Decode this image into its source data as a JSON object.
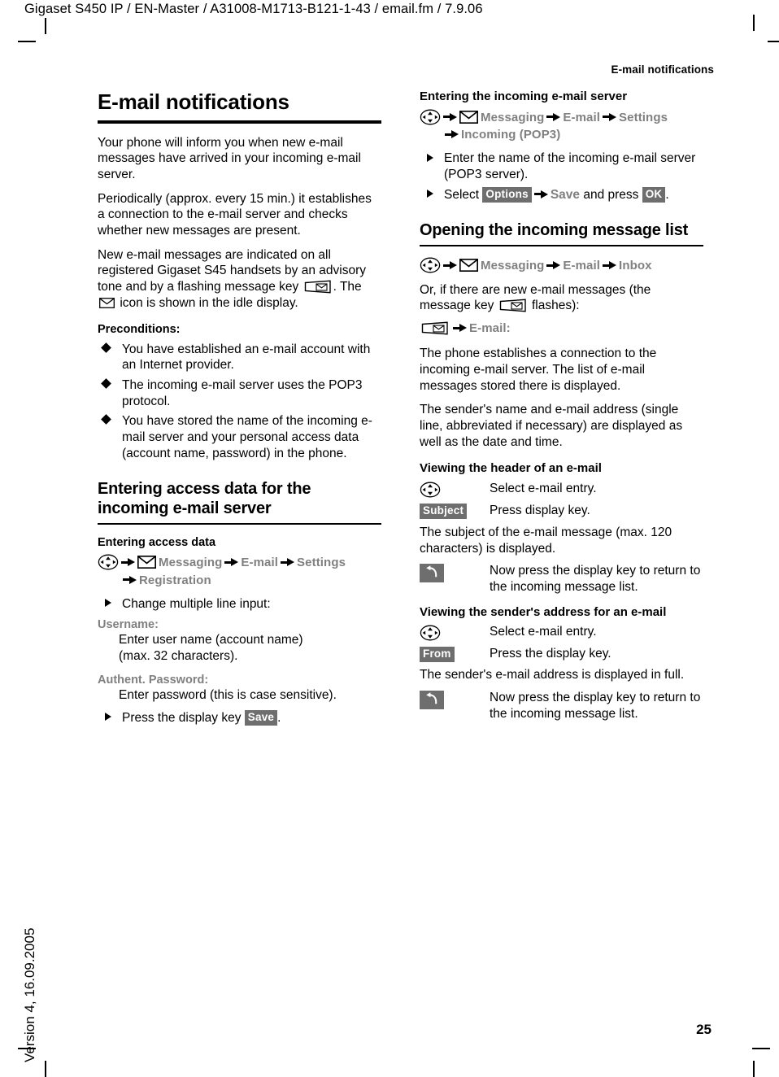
{
  "page": {
    "file_line": "Gigaset S450 IP / EN-Master / A31008-M1713-B121-1-43 / email.fm / 7.9.06",
    "running_head": "E-mail notifications",
    "version_text": "Version 4, 16.09.2005",
    "page_number": "25"
  },
  "left": {
    "chapter_title": "E-mail notifications",
    "intro1": "Your phone will inform you when new e-mail messages have arrived in your incoming e-mail server.",
    "intro2": "Periodically (approx. every 15 min.) it establishes a connection to the e-mail server and checks whether new messages are present.",
    "intro3_a": "New e-mail messages are indicated on all registered Gigaset S45 handsets by an advisory tone and by a flashing message key",
    "intro3_b": ". The",
    "intro3_c": "icon is shown in the idle display.",
    "preconditions_title": "Preconditions:",
    "preconditions": [
      "You have established an e-mail account with an Internet provider.",
      "The incoming e-mail server uses the POP3 protocol.",
      "You have stored the name of the incoming e-mail server and your personal access data (account name, password) in the phone."
    ],
    "section_title": "Entering access data for the incoming e-mail server",
    "access_sub": "Entering access data",
    "menu_path": {
      "item1": "Messaging",
      "item2": "E-mail",
      "item3": "Settings",
      "item4": "Registration"
    },
    "step_change": "Change multiple line input:",
    "username_label": "Username:",
    "username_text_1": "Enter user name (account name)",
    "username_text_2": "(max. 32 characters).",
    "password_label": "Authent. Password:",
    "password_text": "Enter password (this is case sensitive).",
    "press_save_prefix": "Press the display key",
    "save_key": "Save",
    "press_save_suffix": "."
  },
  "right": {
    "incoming_sub": "Entering the incoming e-mail server",
    "menu_path": {
      "item1": "Messaging",
      "item2": "E-mail",
      "item3": "Settings",
      "item4": "Incoming (POP3)"
    },
    "step_enter": "Enter the name of the incoming e-mail server (POP3 server).",
    "step_select_prefix": "Select",
    "options_key": "Options",
    "step_select_mid": "Save",
    "step_select_and": "and press",
    "ok_key": "OK",
    "step_select_suffix": ".",
    "opening_title": "Opening the incoming message list",
    "menu_path2": {
      "item1": "Messaging",
      "item2": "E-mail",
      "item3": "Inbox"
    },
    "or_line_a": "Or, if there are new e-mail messages (the message key",
    "or_line_b": "flashes):",
    "msgkey_path_item": "E-mail:",
    "para1": "The phone establishes a connection to the incoming e-mail server. The list of e-mail messages stored there is displayed.",
    "para2": "The sender's name and e-mail address (single line, abbreviated if necessary) are displayed as well as the date and time.",
    "header_sub": "Viewing the header of an e-mail",
    "header_row1": "Select e-mail entry.",
    "subject_key": "Subject",
    "header_row2": "Press display key.",
    "header_para": "The subject of the e-mail message (max. 120 characters) is displayed.",
    "header_row3": "Now press the display key to return to the incoming message list.",
    "sender_sub": "Viewing the sender's address for an e-mail",
    "sender_row1": "Select e-mail entry.",
    "from_key": "From",
    "sender_row2": "Press the display key.",
    "sender_para": "The sender's e-mail address is displayed in full.",
    "sender_row3": "Now press the display key to return to the incoming message list."
  },
  "colors": {
    "menu_gray": "#808080",
    "key_bg": "#6e6e6e",
    "key_fg": "#ffffff"
  }
}
